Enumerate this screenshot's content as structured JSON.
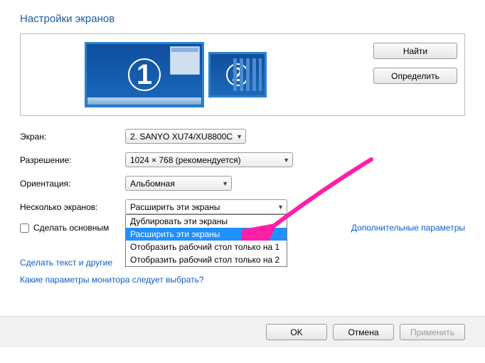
{
  "title": "Настройки экранов",
  "monitors": {
    "m1": "1",
    "m2": "2"
  },
  "side_buttons": {
    "find": "Найти",
    "identify": "Определить"
  },
  "labels": {
    "screen": "Экран:",
    "resolution": "Разрешение:",
    "orientation": "Ориентация:",
    "multiple": "Несколько экранов:",
    "make_primary": "Сделать основным"
  },
  "selects": {
    "screen": "2. SANYO XU74/XU8800C",
    "resolution": "1024 × 768 (рекомендуется)",
    "orientation": "Альбомная",
    "multiple": "Расширить эти экраны"
  },
  "dropdown": {
    "opt0": "Дублировать эти экраны",
    "opt1": "Расширить эти экраны",
    "opt2": "Отобразить рабочий стол только на 1",
    "opt3": "Отобразить рабочий стол только на 2"
  },
  "links": {
    "advanced": "Дополнительные параметры",
    "textsize": "Сделать текст и другие",
    "whichmon": "Какие параметры монитора следует выбрать?"
  },
  "buttons": {
    "ok": "OK",
    "cancel": "Отмена",
    "apply": "Применить"
  }
}
